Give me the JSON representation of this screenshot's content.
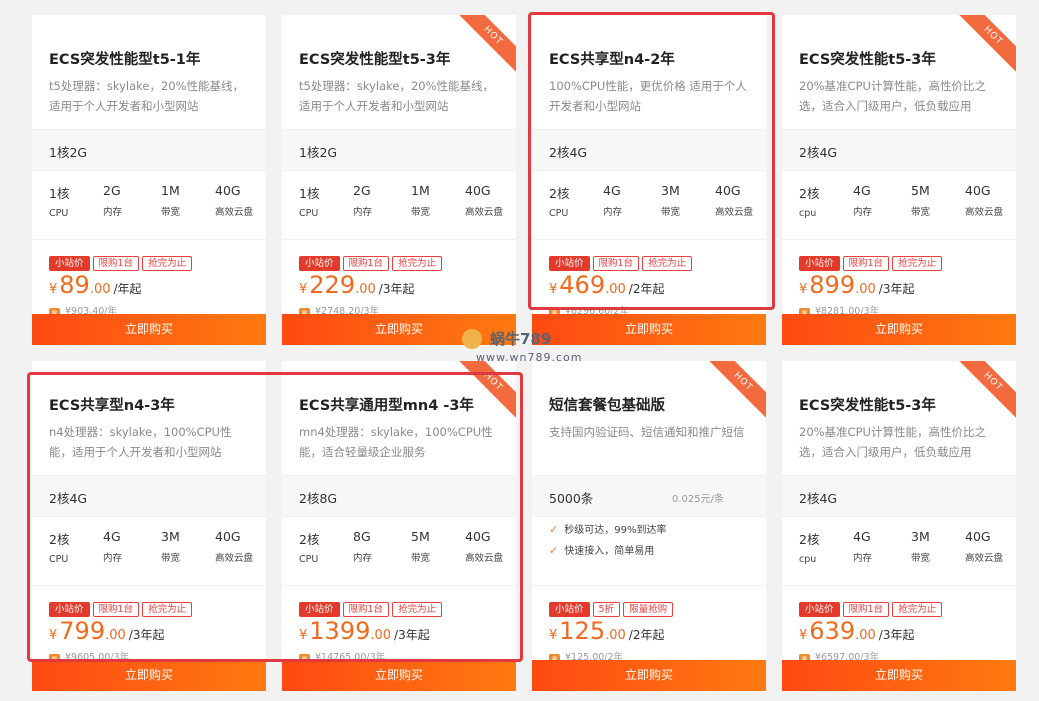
{
  "cards": [
    {
      "title": "ECS突发性能型t5-1年",
      "desc": "t5处理器：skylake，20%性能基线，适用于个人开发者和小型网站",
      "config": "1核2G",
      "unit_price": "",
      "params": [
        {
          "value": "1核",
          "label": "CPU"
        },
        {
          "value": "2G",
          "label": "内存"
        },
        {
          "value": "1M",
          "label": "带宽"
        },
        {
          "value": "40G",
          "label": "高效云盘"
        }
      ],
      "features": [],
      "tags": [
        "小站价",
        "限购1台",
        "抢完为止"
      ],
      "currency": "¥",
      "price_int": "89",
      "price_dec": ".00",
      "price_unit": "/年起",
      "orig_price": "¥903.40/年",
      "hot": false,
      "buy_label": "立即购买"
    },
    {
      "title": "ECS突发性能型t5-3年",
      "desc": "t5处理器：skylake，20%性能基线，适用于个人开发者和小型网站",
      "config": "1核2G",
      "unit_price": "",
      "params": [
        {
          "value": "1核",
          "label": "CPU"
        },
        {
          "value": "2G",
          "label": "内存"
        },
        {
          "value": "1M",
          "label": "带宽"
        },
        {
          "value": "40G",
          "label": "高效云盘"
        }
      ],
      "features": [],
      "tags": [
        "小站价",
        "限购1台",
        "抢完为止"
      ],
      "currency": "¥",
      "price_int": "229",
      "price_dec": ".00",
      "price_unit": "/3年起",
      "orig_price": "¥2748.20/3年",
      "hot": true,
      "buy_label": "立即购买"
    },
    {
      "title": "ECS共享型n4-2年",
      "desc": "100%CPU性能，更优价格 适用于个人开发者和小型网站",
      "config": "2核4G",
      "unit_price": "",
      "params": [
        {
          "value": "2核",
          "label": "CPU"
        },
        {
          "value": "4G",
          "label": "内存"
        },
        {
          "value": "3M",
          "label": "带宽"
        },
        {
          "value": "40G",
          "label": "高效云盘"
        }
      ],
      "features": [],
      "tags": [
        "小站价",
        "限购1台",
        "抢完为止"
      ],
      "currency": "¥",
      "price_int": "469",
      "price_dec": ".00",
      "price_unit": "/2年起",
      "orig_price": "¥6296.60/2年",
      "hot": false,
      "buy_label": "立即购买"
    },
    {
      "title": "ECS突发性能t5-3年",
      "desc": "20%基准CPU计算性能，高性价比之选，适合入门级用户，低负载应用",
      "config": "2核4G",
      "unit_price": "",
      "params": [
        {
          "value": "2核",
          "label": "cpu"
        },
        {
          "value": "4G",
          "label": "内存"
        },
        {
          "value": "5M",
          "label": "带宽"
        },
        {
          "value": "40G",
          "label": "高效云盘"
        }
      ],
      "features": [],
      "tags": [
        "小站价",
        "限购1台",
        "抢完为止"
      ],
      "currency": "¥",
      "price_int": "899",
      "price_dec": ".00",
      "price_unit": "/3年起",
      "orig_price": "¥8281.00/3年",
      "hot": true,
      "buy_label": "立即购买"
    },
    {
      "title": "ECS共享型n4-3年",
      "desc": "n4处理器：skylake，100%CPU性能，适用于个人开发者和小型网站",
      "config": "2核4G",
      "unit_price": "",
      "params": [
        {
          "value": "2核",
          "label": "CPU"
        },
        {
          "value": "4G",
          "label": "内存"
        },
        {
          "value": "3M",
          "label": "带宽"
        },
        {
          "value": "40G",
          "label": "高效云盘"
        }
      ],
      "features": [],
      "tags": [
        "小站价",
        "限购1台",
        "抢完为止"
      ],
      "currency": "¥",
      "price_int": "799",
      "price_dec": ".00",
      "price_unit": "/3年起",
      "orig_price": "¥9605.00/3年",
      "hot": false,
      "buy_label": "立即购买"
    },
    {
      "title": "ECS共享通用型mn4 -3年",
      "desc": "mn4处理器：skylake，100%CPU性能，适合轻量级企业服务",
      "config": "2核8G",
      "unit_price": "",
      "params": [
        {
          "value": "2核",
          "label": "CPU"
        },
        {
          "value": "8G",
          "label": "内存"
        },
        {
          "value": "5M",
          "label": "带宽"
        },
        {
          "value": "40G",
          "label": "高效云盘"
        }
      ],
      "features": [],
      "tags": [
        "小站价",
        "限购1台",
        "抢完为止"
      ],
      "currency": "¥",
      "price_int": "1399",
      "price_dec": ".00",
      "price_unit": "/3年起",
      "orig_price": "¥14765.00/3年",
      "hot": true,
      "buy_label": "立即购买"
    },
    {
      "title": "短信套餐包基础版",
      "desc": "支持国内验证码、短信通知和推广短信",
      "config": "5000条",
      "unit_price": "0.025元/条",
      "params": [],
      "features": [
        "秒级可达，99%到达率",
        "快速接入，简单易用"
      ],
      "tags": [
        "小站价",
        "5折",
        "限量抢购"
      ],
      "currency": "¥",
      "price_int": "125",
      "price_dec": ".00",
      "price_unit": "/2年起",
      "orig_price": "¥125.00/2年",
      "hot": true,
      "buy_label": "立即购买"
    },
    {
      "title": "ECS突发性能t5-3年",
      "desc": "20%基准CPU计算性能，高性价比之选，适合入门级用户，低负载应用",
      "config": "2核4G",
      "unit_price": "",
      "params": [
        {
          "value": "2核",
          "label": "cpu"
        },
        {
          "value": "4G",
          "label": "内存"
        },
        {
          "value": "3M",
          "label": "带宽"
        },
        {
          "value": "40G",
          "label": "高效云盘"
        }
      ],
      "features": [],
      "tags": [
        "小站价",
        "限购1台",
        "抢完为止"
      ],
      "currency": "¥",
      "price_int": "639",
      "price_dec": ".00",
      "price_unit": "/3年起",
      "orig_price": "¥6597.00/3年",
      "hot": true,
      "buy_label": "立即购买"
    }
  ],
  "hot_label": "HOT",
  "watermark": {
    "text": "蜗牛789",
    "url": "www.wn789.com"
  },
  "colors": {
    "accent": "#ff5a14",
    "price": "#f06a1d",
    "tag": "#e64040",
    "highlight": "#e0393f"
  }
}
